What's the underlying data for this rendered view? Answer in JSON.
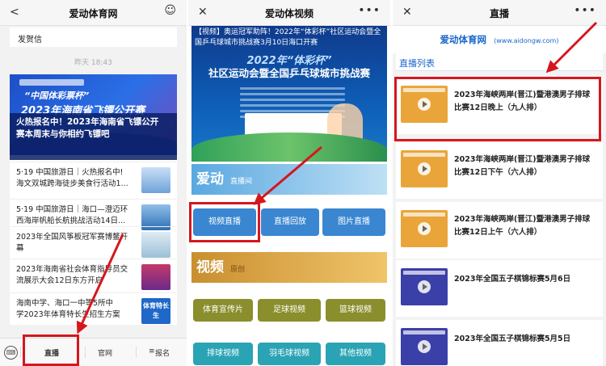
{
  "panel1": {
    "greeting": "发贺信",
    "timestamp": "昨天 18:43",
    "banner": {
      "line1": "“中国体彩票杯”",
      "line2": "2023年海南省飞镖公开赛"
    },
    "feature_title": [
      "火热报名中！2023年海南省飞镖公开",
      "赛本周末与你相约飞镖吧"
    ],
    "news": [
      {
        "lines": [
          "5·19 中国旅游日｜火热报名中!",
          "海文双城跨海徒步美食行活动1..."
        ]
      },
      {
        "lines": [
          "5·19 中国旅游日｜海口—澄迈环",
          "西海岸帆船长航挑战活动14日..."
        ]
      },
      {
        "lines": [
          "2023年全国风筝板冠军赛博鳌开",
          "幕"
        ]
      },
      {
        "lines": [
          "2023年海南省社会体育指导员交",
          "流展示大会12日东方开启"
        ]
      },
      {
        "lines": [
          "海南中学、海口一中等5所中",
          "学2023年体育特长生招生方案"
        ]
      }
    ],
    "thumb_text": "体育特长生",
    "tabs": {
      "live": "直播",
      "site": "官网",
      "signup": "报名"
    }
  },
  "panel2": {
    "title": "爱动体视频",
    "poster": {
      "headline": "【视频】奥运冠军助阵！2022年“体彩杯”社区运动会暨全国乒乓球城市挑战赛3月10日海口开赛",
      "big1": "2022年“体彩杯”",
      "big2": "社区运动会暨全国乒乓球城市挑战赛"
    },
    "section1": {
      "main": "爱动",
      "sub": "直播间"
    },
    "buttons1": [
      "视频直播",
      "直播回放",
      "图片直播"
    ],
    "section2": {
      "main": "视频",
      "sub": "原创"
    },
    "buttons2": [
      "体育宣传片",
      "足球视频",
      "篮球视频"
    ],
    "buttons3": [
      "排球视频",
      "羽毛球视频",
      "其他视频"
    ]
  },
  "panel3": {
    "title": "直播",
    "logo_name": "爱动体育网",
    "logo_url": "(www.aidongw.com)",
    "list_title": "直播列表",
    "items": [
      {
        "title": "2023年海峡两岸(晋江)暨港澳男子排球比赛12日晚上（九人排）",
        "thumb_color": "#e9a53a"
      },
      {
        "title": "2023年海峡两岸(晋江)暨港澳男子排球比赛12日下午（六人排）",
        "thumb_color": "#e9a53a"
      },
      {
        "title": "2023年海峡两岸(晋江)暨港澳男子排球比赛12日上午（六人排）",
        "thumb_color": "#e9a53a"
      },
      {
        "title": "2023年全国五子棋锦标赛5月6日",
        "thumb_color": "#3b3fa8"
      },
      {
        "title": "2023年全国五子棋锦标赛5月5日",
        "thumb_color": "#3b3fa8"
      }
    ]
  },
  "colors": {
    "accent": "#1a66cc",
    "highlight": "#d5171d",
    "button_blue": "#3a86d0",
    "button_teal": "#2aa3b4"
  }
}
